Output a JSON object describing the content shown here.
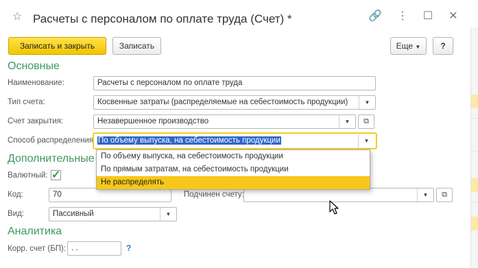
{
  "window": {
    "title": "Расчеты с персоналом по оплате труда (Счет) *",
    "star_icon": "star-icon",
    "link_icon": "link-icon",
    "more_icon": "more-vertical-icon",
    "maximize_icon": "maximize-icon",
    "close_icon": "close-icon"
  },
  "toolbar": {
    "save_close_label": "Записать и закрыть",
    "save_label": "Записать",
    "more_label": "Еще",
    "help_label": "?"
  },
  "sections": {
    "main": "Основные",
    "additional": "Дополнительные",
    "analytics": "Аналитика"
  },
  "fields": {
    "name_label": "Наименование:",
    "name_value": "Расчеты с персоналом по оплате труда",
    "account_type_label": "Тип счета:",
    "account_type_value": "Косвенные затраты (распределяемые на себестоимость продукции)",
    "closing_account_label": "Счет закрытия:",
    "closing_account_value": "Незавершенное производство",
    "distribution_label": "Способ распределения:",
    "distribution_value": "По объему выпуска, на себестоимость продукции",
    "currency_label": "Валютный:",
    "currency_checked": true,
    "code_label": "Код:",
    "code_value": "70",
    "parent_label": "Подчинен счету:",
    "parent_value": "",
    "kind_label": "Вид:",
    "kind_value": "Пассивный",
    "corr_account_label": "Корр. счет (БП):",
    "corr_account_value": " .  .",
    "corr_help": "?"
  },
  "dropdown": {
    "options": [
      "По объему выпуска, на себестоимость продукции",
      "По прямым затратам, на себестоимость продукции",
      "Не распределять"
    ],
    "highlighted_index": 2
  },
  "colors": {
    "accent_green": "#3c9a5f",
    "primary_button": "#f2c400",
    "selection_blue": "#2f66c9",
    "highlight_yellow": "#f7c81a"
  }
}
